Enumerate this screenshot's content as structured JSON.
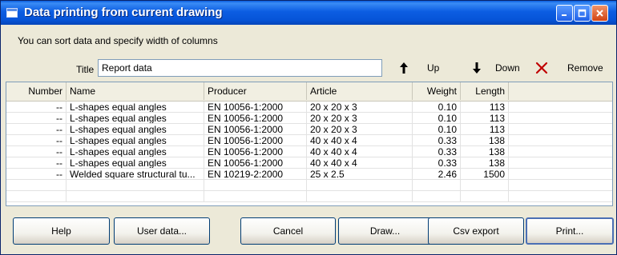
{
  "window": {
    "title": "Data printing from current drawing"
  },
  "hint": "You can sort data and specify width of columns",
  "title_field": {
    "label": "Title",
    "value": "Report data"
  },
  "toolbar": {
    "up_label": "Up",
    "down_label": "Down",
    "remove_label": "Remove"
  },
  "grid": {
    "columns": [
      "Number",
      "Name",
      "Producer",
      "Article",
      "Weight",
      "Length"
    ],
    "rows": [
      [
        "--",
        "L-shapes equal angles",
        "EN 10056-1:2000",
        "20 x 20 x 3",
        "0.10",
        "113"
      ],
      [
        "--",
        "L-shapes equal angles",
        "EN 10056-1:2000",
        "20 x 20 x 3",
        "0.10",
        "113"
      ],
      [
        "--",
        "L-shapes equal angles",
        "EN 10056-1:2000",
        "20 x 20 x 3",
        "0.10",
        "113"
      ],
      [
        "--",
        "L-shapes equal angles",
        "EN 10056-1:2000",
        "40 x 40 x 4",
        "0.33",
        "138"
      ],
      [
        "--",
        "L-shapes equal angles",
        "EN 10056-1:2000",
        "40 x 40 x 4",
        "0.33",
        "138"
      ],
      [
        "--",
        "L-shapes equal angles",
        "EN 10056-1:2000",
        "40 x 40 x 4",
        "0.33",
        "138"
      ],
      [
        "--",
        "Welded square structural tu...",
        "EN 10219-2:2000",
        "25 x 2.5",
        "2.46",
        "1500"
      ]
    ]
  },
  "buttons": {
    "help": "Help",
    "user_data": "User data...",
    "cancel": "Cancel",
    "draw": "Draw...",
    "csv_export": "Csv export",
    "print": "Print..."
  },
  "colors": {
    "titlebar": "#0a5fe0",
    "dialog": "#ece9d8",
    "remove_icon": "#c00000"
  },
  "icons": [
    "window-icon",
    "minimize-icon",
    "maximize-icon",
    "close-icon",
    "arrow-up-icon",
    "arrow-down-icon",
    "remove-x-icon"
  ]
}
